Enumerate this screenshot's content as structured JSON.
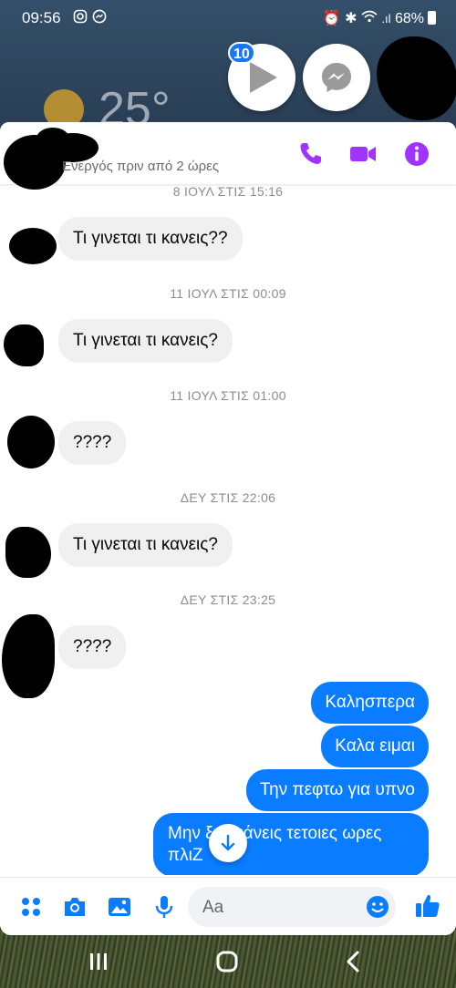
{
  "status_bar": {
    "time": "09:56",
    "battery": "68%",
    "left_icons": [
      "instagram-icon",
      "messenger-icon"
    ],
    "right_icons": [
      "alarm-icon",
      "bluetooth-icon",
      "wifi-icon",
      "signal-icon",
      "battery-icon"
    ]
  },
  "home": {
    "weather_temp": "25°"
  },
  "chat_heads": {
    "badge_count": "10"
  },
  "header": {
    "status": "Ενεργός πριν από 2 ώρες",
    "icons": [
      "phone-icon",
      "video-icon",
      "info-icon"
    ],
    "accent_color": "#a033ff"
  },
  "conversation": {
    "timestamps": [
      "8 ΙΟΥΛ ΣΤΙΣ 15:16",
      "11 ΙΟΥΛ ΣΤΙΣ 00:09",
      "11 ΙΟΥΛ ΣΤΙΣ 01:00",
      "ΔΕΥ ΣΤΙΣ 22:06",
      "ΔΕΥ ΣΤΙΣ 23:25"
    ],
    "incoming": [
      "Τι γινεται τι κανεις??",
      "Τι γινεται τι κανεις?",
      "????",
      "Τι γινεται τι κανεις?",
      "????"
    ],
    "outgoing": [
      "Καλησπερα",
      "Καλα ειμαι",
      "Την πεφτω για υπνο",
      "Μην ξυπνάνεις τετοιες ωρες πλιΖ"
    ],
    "outgoing_color": "#0a7cff"
  },
  "composer": {
    "placeholder": "Aa",
    "icons": [
      "apps-icon",
      "camera-icon",
      "gallery-icon",
      "microphone-icon",
      "emoji-icon",
      "thumbs-up-icon"
    ]
  },
  "nav": {
    "buttons": [
      "recents-button",
      "home-button",
      "back-button"
    ]
  }
}
